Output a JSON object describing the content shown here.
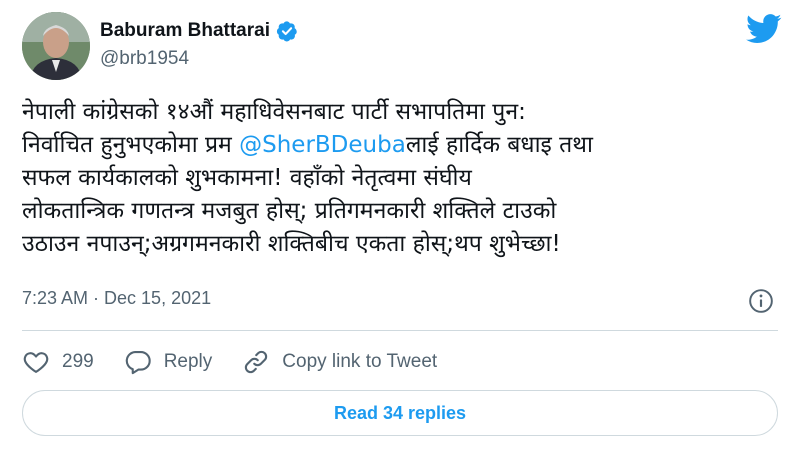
{
  "author": {
    "display_name": "Baburam Bhattarai",
    "handle": "@brb1954",
    "verified": true
  },
  "tweet": {
    "lines": [
      [
        "नेपाली कांग्रेसको १४औं महाधिवेसनबाट पार्टी सभापतिमा पुन:"
      ],
      [
        "निर्वाचित हुनुभएकोमा प्रम ",
        "@SherBDeuba",
        "लाई हार्दिक बधाइ तथा"
      ],
      [
        "सफल कार्यकालको शुभकामना! वहाँको नेतृत्वमा संघीय"
      ],
      [
        "लोकतान्त्रिक गणतन्त्र मजबुत होस्; प्रतिगमनकारी शक्तिले टाउको"
      ],
      [
        "उठाउन नपाउन्;अग्रगमनकारी शक्तिबीच एकता होस्;थप शुभेच्छा!"
      ]
    ],
    "timestamp": "7:23 AM · Dec 15, 2021"
  },
  "actions": {
    "like_count": "299",
    "reply_label": "Reply",
    "copy_label": "Copy link to Tweet"
  },
  "read_replies_label": "Read 34 replies",
  "colors": {
    "accent": "#1d9bf0",
    "muted": "#536471",
    "text": "#0f1419",
    "border": "#cfd9de"
  },
  "icons": {
    "verified": "verified-badge-icon",
    "logo": "twitter-bird-icon",
    "info": "info-icon",
    "like": "heart-icon",
    "reply": "speech-bubble-icon",
    "copy": "link-icon"
  }
}
